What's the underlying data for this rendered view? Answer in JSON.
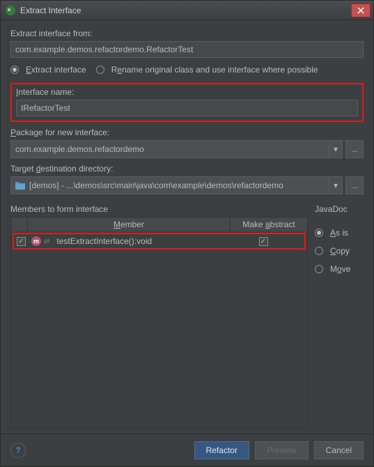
{
  "window": {
    "title": "Extract Interface"
  },
  "from": {
    "label": "Extract interface from:",
    "value": "com.example.demos.refactordemo.RefactorTest"
  },
  "mode": {
    "extract": "Extract interface",
    "rename": "Rename original class and use interface where possible",
    "selected": "extract"
  },
  "iface": {
    "label": "Interface name:",
    "value": "IRefactorTest"
  },
  "pkg": {
    "label": "Package for new interface:",
    "value": "com.example.demos.refactordemo"
  },
  "dest": {
    "label": "Target destination directory:",
    "value": "[demos] - ...\\demos\\src\\main\\java\\com\\example\\demos\\refactordemo"
  },
  "members": {
    "title": "Members to form interface",
    "header_member": "Member",
    "header_abstract": "Make abstract",
    "rows": [
      {
        "checked": true,
        "name": "testExtractInterface():void",
        "abstract": true
      }
    ]
  },
  "javadoc": {
    "title": "JavaDoc",
    "asis": "As is",
    "copy": "Copy",
    "move": "Move",
    "selected": "asis"
  },
  "footer": {
    "refactor": "Refactor",
    "preview": "Preview",
    "cancel": "Cancel"
  }
}
